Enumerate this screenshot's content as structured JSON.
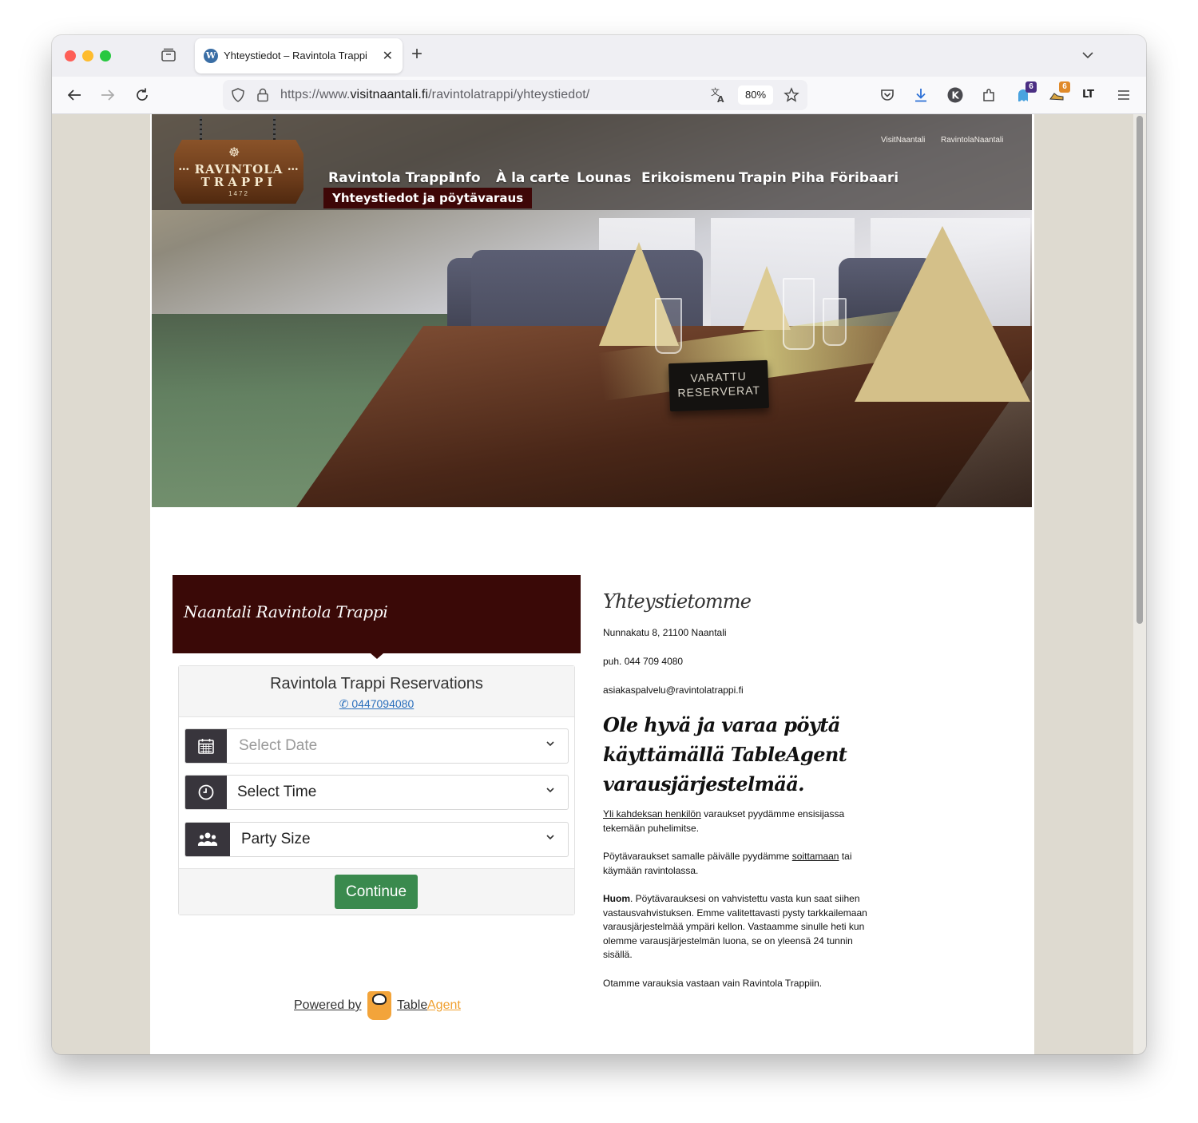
{
  "browser": {
    "tab_title": "Yhteystiedot – Ravintola Trappi",
    "url_prefix": "https://www.",
    "url_host": "visitnaantali.fi",
    "url_path": "/ravintolatrappi/yhteystiedot/",
    "zoom": "80%",
    "ext_badge_1": "6",
    "ext_badge_2": "6",
    "ext_lt": "LT"
  },
  "site": {
    "logo": {
      "line1": "RAVINTOLA",
      "line2": "TRAPPI",
      "line3": "1472",
      "dots": "•••"
    },
    "top_links": [
      "VisitNaantali",
      "RavintolaNaantali"
    ],
    "menu": [
      "Ravintola Trappi",
      "Info",
      "À la carte",
      "Lounas",
      "Erikoismenu",
      "Trapin Piha",
      "Föribaari"
    ],
    "menu_active": "Yhteystiedot ja pöytävaraus",
    "hero_sign": {
      "line1": "VARATTU",
      "line2": "RESERVERAT"
    }
  },
  "reservation": {
    "header": "Naantali Ravintola Trappi",
    "widget_title": "Ravintola Trappi Reservations",
    "phone": "0447094080",
    "date_placeholder": "Select Date",
    "time_label": "Select Time",
    "party_label": "Party Size",
    "continue": "Continue",
    "powered_by": "Powered by",
    "brand_1": "Table",
    "brand_2": "Agent"
  },
  "contact": {
    "title": "Yhteystietomme",
    "address": "Nunnakatu 8, 21100 Naantali",
    "phone": "puh. 044 709 4080",
    "email": "asiakaspalvelu@ravintolatrappi.fi",
    "heading": "Ole hyvä ja varaa pöytä käyttämällä TableAgent varausjärjestelmää.",
    "p1_link": "Yli kahdeksan henkilön",
    "p1_rest": " varaukset pyydämme ensisijassa tekemään puhelimitse.",
    "p2_pre": "Pöytävaraukset samalle päivälle pyydämme ",
    "p2_link": "soittamaan",
    "p2_rest": " tai käymään ravintolassa.",
    "p3_bold": "Huom",
    "p3_rest": ". Pöytävarauksesi on vahvistettu vasta kun saat siihen vastausvahvistuksen. Emme valitettavasti pysty tarkkailemaan varausjärjestelmää ympäri kellon. Vastaamme sinulle heti kun olemme varausjärjestelmän luona, se on yleensä 24 tunnin sisällä.",
    "p4": "Otamme varauksia vastaan vain Ravintola Trappiin."
  },
  "colors": {
    "header_maroon": "#3a0907",
    "menu_active_bg": "#3e0707",
    "continue_green": "#3a8a4e",
    "link_blue": "#2a6fbc",
    "tableagent_orange": "#f0a030",
    "page_bg": "#dedad0"
  }
}
